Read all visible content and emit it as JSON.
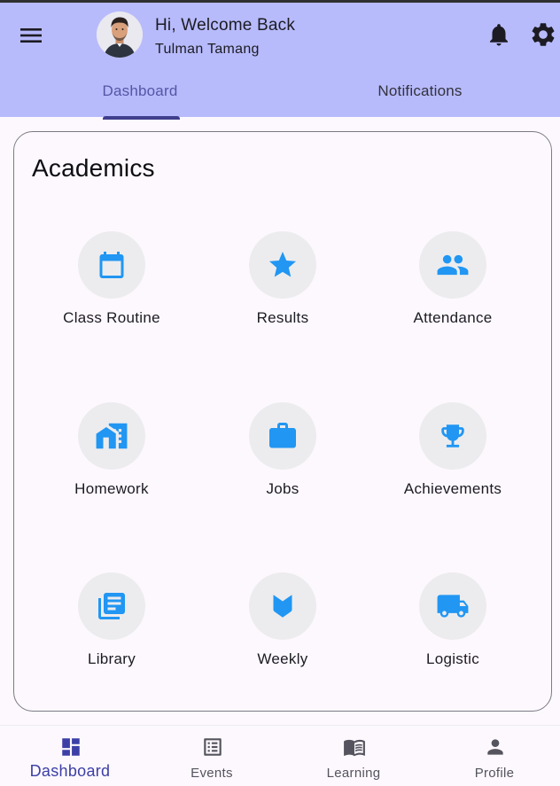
{
  "header": {
    "greeting": "Hi, Welcome Back",
    "user_name": "Tulman Tamang",
    "background_color": "#b7bbfb",
    "icons": [
      "menu-icon",
      "bell-icon",
      "gear-icon"
    ]
  },
  "tabs": [
    {
      "label": "Dashboard",
      "active": true
    },
    {
      "label": "Notifications",
      "active": false
    }
  ],
  "academics": {
    "title": "Academics",
    "accent_color": "#2196f3",
    "items": [
      {
        "label": "Class Routine",
        "icon": "calendar-icon"
      },
      {
        "label": "Results",
        "icon": "star-icon"
      },
      {
        "label": "Attendance",
        "icon": "people-icon"
      },
      {
        "label": "Homework",
        "icon": "home-work-icon"
      },
      {
        "label": "Jobs",
        "icon": "briefcase-icon"
      },
      {
        "label": "Achievements",
        "icon": "trophy-icon"
      },
      {
        "label": "Library",
        "icon": "library-books-icon"
      },
      {
        "label": "Weekly",
        "icon": "label-tag-icon"
      },
      {
        "label": "Logistic",
        "icon": "truck-icon"
      }
    ]
  },
  "bottom_nav": {
    "items": [
      {
        "label": "Dashboard",
        "icon": "dashboard-icon",
        "active": true
      },
      {
        "label": "Events",
        "icon": "list-alt-icon",
        "active": false
      },
      {
        "label": "Learning",
        "icon": "book-icon",
        "active": false
      },
      {
        "label": "Profile",
        "icon": "person-icon",
        "active": false
      }
    ],
    "active_color": "#3b3fa6"
  }
}
